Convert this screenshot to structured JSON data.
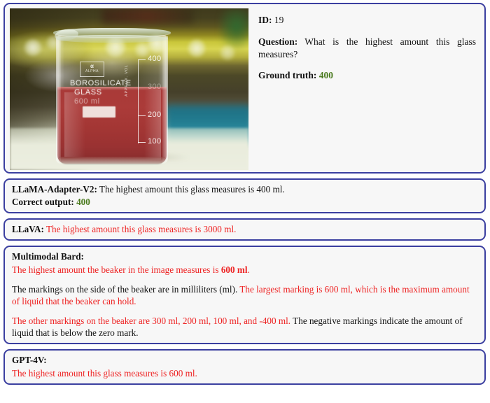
{
  "meta": {
    "id_label": "ID:",
    "id_value": "19",
    "question_label": "Question:",
    "question_text": "What is the highest amount this glass measures?",
    "ground_truth_label": "Ground truth:",
    "ground_truth_value": "400"
  },
  "colors": {
    "panel_border": "#3b3fa0",
    "panel_background": "#f7f7f7",
    "correct_green": "#4a7a1e",
    "error_red": "#ee2222"
  },
  "image": {
    "alt_name": "beaker-photo",
    "etched": {
      "logo_symbol": "α",
      "logo_name": "ALPHA",
      "line1": "BOROSILICATE",
      "line2": "GLASS",
      "line3": "600 ml",
      "approx_vol": "APPROX. VOL"
    },
    "graduations": [
      {
        "label": "400",
        "faint": false
      },
      {
        "label": "300",
        "faint": true
      },
      {
        "label": "200",
        "faint": false
      },
      {
        "label": "100",
        "faint": false
      }
    ]
  },
  "responses": [
    {
      "name": "llama-adapter-v2",
      "title": "LLaMA-Adapter-V2:",
      "title_inline": true,
      "lines": [
        {
          "parts": [
            {
              "text": "The highest amount this glass measures is 400 ml.",
              "style": "plain"
            }
          ]
        },
        {
          "parts": [
            {
              "text": "Correct output:",
              "style": "bold"
            },
            {
              "text": " ",
              "style": "plain"
            },
            {
              "text": "400",
              "style": "green-bold"
            }
          ]
        }
      ]
    },
    {
      "name": "llava",
      "title": "LLaVA:",
      "title_inline": true,
      "lines": [
        {
          "parts": [
            {
              "text": "The highest amount this glass measures is 3000 ml.",
              "style": "red"
            }
          ]
        }
      ]
    },
    {
      "name": "multimodal-bard",
      "title": "Multimodal Bard:",
      "title_inline": false,
      "lines": [
        {
          "parts": [
            {
              "text": "The highest amount the beaker in the image measures is ",
              "style": "red"
            },
            {
              "text": "600 ml",
              "style": "red-bold"
            },
            {
              "text": ".",
              "style": "red"
            }
          ]
        },
        {
          "parts": [],
          "spacer": true
        },
        {
          "parts": [
            {
              "text": "The markings on the side of the beaker are in milliliters (ml). ",
              "style": "plain"
            },
            {
              "text": "The largest marking is 600 ml, which is the maximum amount of liquid that the beaker can hold.",
              "style": "red"
            }
          ]
        },
        {
          "parts": [],
          "spacer": true
        },
        {
          "parts": [
            {
              "text": "The other markings on the beaker are 300 ml, 200 ml, 100 ml, and -400 ml.",
              "style": "red"
            },
            {
              "text": " The negative markings indicate the amount of liquid that is below the zero mark.",
              "style": "plain"
            }
          ]
        }
      ]
    },
    {
      "name": "gpt-4v",
      "title": "GPT-4V:",
      "title_inline": false,
      "lines": [
        {
          "parts": [
            {
              "text": "The highest amount this glass measures is 600 ml.",
              "style": "red"
            }
          ]
        }
      ]
    }
  ]
}
